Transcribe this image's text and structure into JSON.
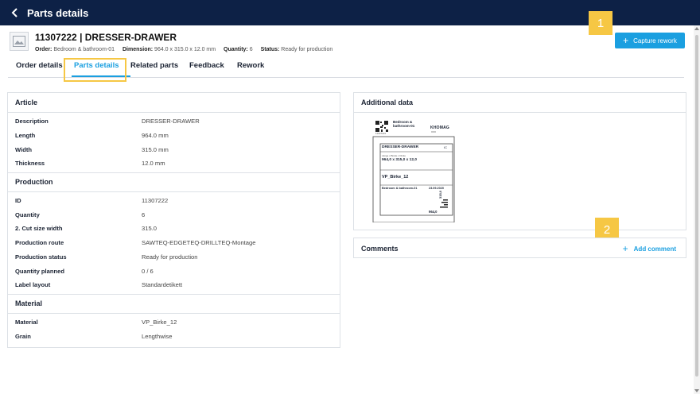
{
  "topbar": {
    "title": "Parts details",
    "back_icon": "chevron-left-icon"
  },
  "header": {
    "title": "11307222 | DRESSER-DRAWER",
    "meta": [
      {
        "label": "Order:",
        "value": "Bedroom & bathroom-01"
      },
      {
        "label": "Dimension:",
        "value": "964.0 x 315.0 x 12.0 mm"
      },
      {
        "label": "Quantity:",
        "value": "6"
      },
      {
        "label": "Status:",
        "value": "Ready for production"
      }
    ]
  },
  "actions": {
    "capture_rework": "Capture rework"
  },
  "markers": [
    "1",
    "2"
  ],
  "tabs": [
    "Order details",
    "Parts details",
    "Related parts",
    "Feedback",
    "Rework"
  ],
  "active_tab": "Parts details",
  "article": {
    "title": "Article",
    "rows": [
      {
        "k": "Description",
        "v": "DRESSER-DRAWER"
      },
      {
        "k": "Length",
        "v": "964.0 mm"
      },
      {
        "k": "Width",
        "v": "315.0 mm"
      },
      {
        "k": "Thickness",
        "v": "12.0 mm"
      }
    ]
  },
  "production": {
    "title": "Production",
    "rows": [
      {
        "k": "ID",
        "v": "11307222"
      },
      {
        "k": "Quantity",
        "v": "6"
      },
      {
        "k": "2. Cut size width",
        "v": "315.0"
      },
      {
        "k": "Production route",
        "v": "SAWTEQ-EDGETEQ-DRILLTEQ-Montage"
      },
      {
        "k": "Production status",
        "v": "Ready for production"
      },
      {
        "k": "Quantity planned",
        "v": "0 / 6"
      },
      {
        "k": "Label layout",
        "v": "Standardetikett"
      }
    ]
  },
  "material": {
    "title": "Material",
    "rows": [
      {
        "k": "Material",
        "v": "VP_Birke_12"
      },
      {
        "k": "Grain",
        "v": "Lengthwise"
      }
    ]
  },
  "additional": {
    "title": "Additional data",
    "label": {
      "order_line1": "Bedroom &",
      "order_line2": "bathroom-01",
      "brand": "HOMAG",
      "small_id": "11307222",
      "part": "DRESSER-DRAWER",
      "part_suffix": "IC",
      "dims_caption": "Länge x Breite x Dicke",
      "dims": "964,0 x 315,0 x 12,0",
      "material": "VP_Birke_12",
      "order": "Bedroom & bathroom-01",
      "date": "23.09.2020",
      "width_val": "315,0",
      "length_val": "964,0"
    }
  },
  "comments": {
    "title": "Comments",
    "add": "Add comment"
  }
}
